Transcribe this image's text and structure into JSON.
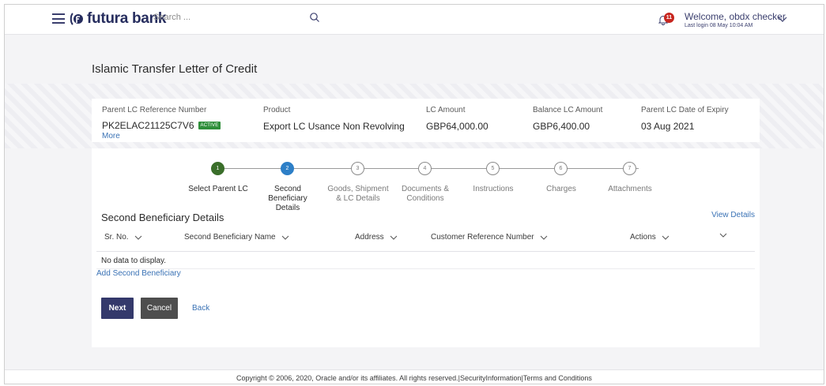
{
  "header": {
    "brand": "futura bank",
    "search_placeholder": "Search ...",
    "notification_count": "11",
    "welcome": "Welcome, obdx checker",
    "last_login": "Last login 08 May 10:04 AM"
  },
  "page": {
    "title": "Islamic Transfer Letter of Credit"
  },
  "summary": {
    "ref_label": "Parent LC Reference Number",
    "ref_value": "PK2ELAC21125C7V6",
    "status": "ACTIVE",
    "more": "More",
    "product_label": "Product",
    "product_value": "Export LC Usance Non Revolving",
    "amount_label": "LC Amount",
    "amount_value": "GBP64,000.00",
    "balance_label": "Balance LC Amount",
    "balance_value": "GBP6,400.00",
    "expiry_label": "Parent LC Date of Expiry",
    "expiry_value": "03 Aug 2021"
  },
  "stepper": {
    "steps": [
      {
        "num": "1",
        "label": "Select Parent LC",
        "state": "done"
      },
      {
        "num": "2",
        "label": "Second Beneficiary Details",
        "state": "current"
      },
      {
        "num": "3",
        "label": "Goods, Shipment & LC Details",
        "state": "pending"
      },
      {
        "num": "4",
        "label": "Documents & Conditions",
        "state": "pending"
      },
      {
        "num": "5",
        "label": "Instructions",
        "state": "pending"
      },
      {
        "num": "6",
        "label": "Charges",
        "state": "pending"
      },
      {
        "num": "7",
        "label": "Attachments",
        "state": "pending"
      }
    ]
  },
  "section": {
    "title": "Second Beneficiary Details",
    "view_details": "View Details",
    "columns": [
      "Sr. No.",
      "Second Beneficiary Name",
      "Address",
      "Customer Reference Number",
      "Actions"
    ],
    "empty": "No data to display.",
    "add_link": "Add Second Beneficiary"
  },
  "actions": {
    "next": "Next",
    "cancel": "Cancel",
    "back": "Back"
  },
  "footer": {
    "copyright": "Copyright © 2006, 2020, Oracle and/or its affiliates. All rights reserved.",
    "security": "SecurityInformation",
    "terms": "Terms and Conditions"
  },
  "colors": {
    "brand": "#262d5e",
    "link": "#3a72b5",
    "step_done": "#3a6e2a",
    "step_current": "#2d7fc7",
    "active_badge": "#2f8f3a",
    "next_button": "#34396b",
    "cancel_button": "#4e4e4e"
  },
  "icons": [
    "hamburger-icon",
    "futura-logo-icon",
    "search-icon",
    "bell-icon",
    "chevron-down-icon"
  ]
}
